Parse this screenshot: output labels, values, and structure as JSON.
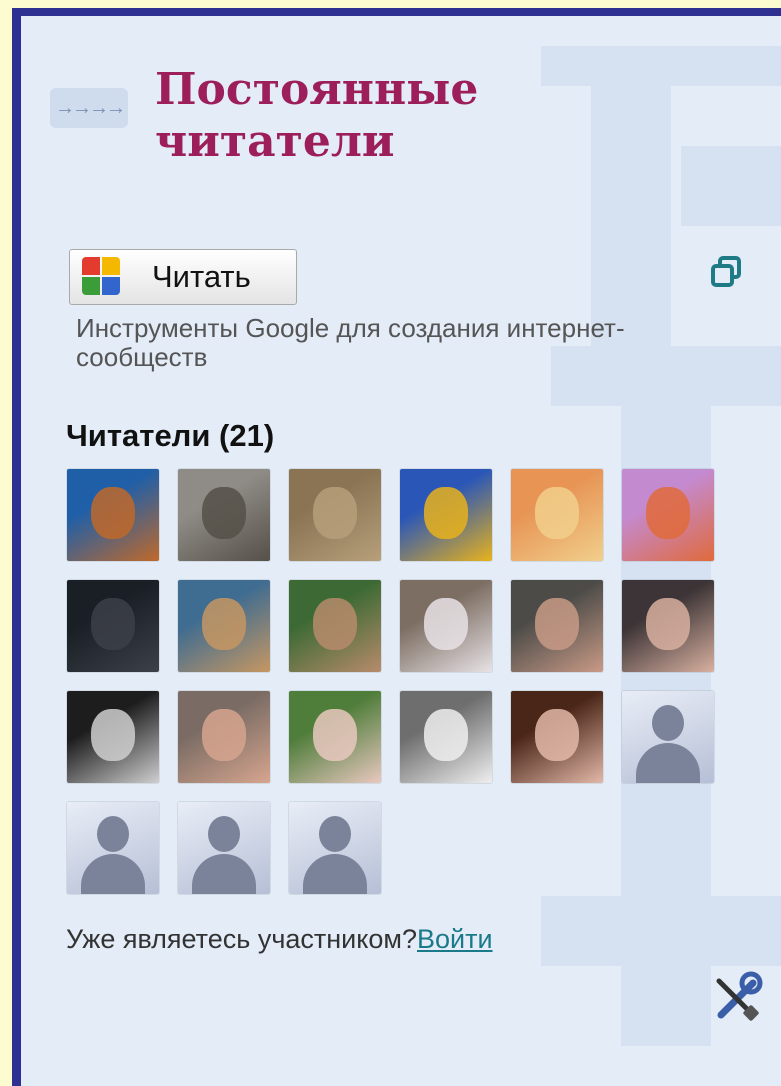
{
  "widget": {
    "title_line1": "Постоянные",
    "title_line2": "читатели",
    "arrows": "→→→→",
    "follow_label": "Читать",
    "description": "Инструменты Google  для создания интернет-сообществ",
    "readers_label": "Читатели (21)",
    "signin_text": "Уже являетесь участником?",
    "signin_link": "Войти"
  },
  "readers": [
    {
      "name": "dog",
      "kind": "photo",
      "colors": [
        "#1f5fa8",
        "#c0692a"
      ]
    },
    {
      "name": "kitten-gray",
      "kind": "photo",
      "colors": [
        "#8f8b86",
        "#555048"
      ]
    },
    {
      "name": "kitten-brown",
      "kind": "photo",
      "colors": [
        "#8a7454",
        "#b79f7a"
      ]
    },
    {
      "name": "anime-boy",
      "kind": "photo",
      "colors": [
        "#2a56b8",
        "#e7b21c"
      ]
    },
    {
      "name": "winx-fairy",
      "kind": "photo",
      "colors": [
        "#e79455",
        "#f1cf8b"
      ]
    },
    {
      "name": "winx-bloom",
      "kind": "photo",
      "colors": [
        "#c48ad0",
        "#e06a3b"
      ]
    },
    {
      "name": "dark-figure",
      "kind": "photo",
      "colors": [
        "#1a1f26",
        "#3c4048"
      ]
    },
    {
      "name": "boy-sea",
      "kind": "photo",
      "colors": [
        "#3f6c91",
        "#c69762"
      ]
    },
    {
      "name": "boy-garden",
      "kind": "photo",
      "colors": [
        "#3d6a34",
        "#b78b6b"
      ]
    },
    {
      "name": "girl-white",
      "kind": "photo",
      "colors": [
        "#7d6e63",
        "#e7e2e5"
      ]
    },
    {
      "name": "boy-glasses",
      "kind": "photo",
      "colors": [
        "#4c4b48",
        "#c89a86"
      ]
    },
    {
      "name": "boy-smile",
      "kind": "photo",
      "colors": [
        "#3c3436",
        "#d8b0a0"
      ]
    },
    {
      "name": "soldier",
      "kind": "photo",
      "colors": [
        "#1d1d1d",
        "#cfcfcf"
      ]
    },
    {
      "name": "boy-portrait",
      "kind": "photo",
      "colors": [
        "#7a6c64",
        "#d6a58e"
      ]
    },
    {
      "name": "girl-flowers",
      "kind": "photo",
      "colors": [
        "#4f7d3a",
        "#e9c8c0"
      ]
    },
    {
      "name": "pinocchio",
      "kind": "photo",
      "colors": [
        "#6e6e6e",
        "#efefef"
      ]
    },
    {
      "name": "woman-curly",
      "kind": "photo",
      "colors": [
        "#4a2618",
        "#e3b8a8"
      ]
    },
    {
      "name": "default-1",
      "kind": "default"
    },
    {
      "name": "default-2",
      "kind": "default"
    },
    {
      "name": "default-3",
      "kind": "default"
    },
    {
      "name": "default-4",
      "kind": "default"
    }
  ],
  "icons": {
    "arrows": "arrows-icon",
    "copy": "copy-icon",
    "google": "google-logo-icon",
    "tools": "tools-icon"
  },
  "colors": {
    "border": "#2e3191",
    "panel": "#e3ecf7",
    "title": "#9c1f5b",
    "link": "#1a7a8a"
  }
}
